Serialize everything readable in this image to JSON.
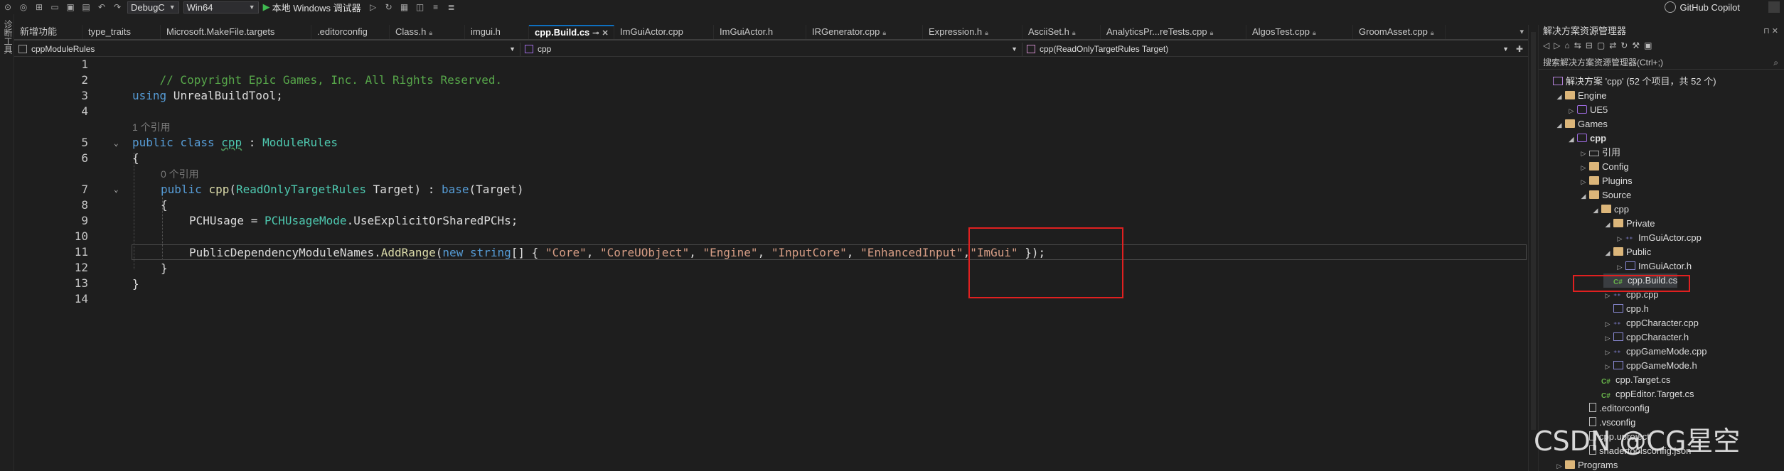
{
  "toolbar": {
    "config": "DebugC",
    "platform": "Win64",
    "run_label": "本地 Windows 调试器",
    "copilot": "GitHub Copilot"
  },
  "side_strip": {
    "label": "诊断工具"
  },
  "tabs": [
    {
      "label": "新增功能",
      "locked": false,
      "active": false
    },
    {
      "label": "type_traits",
      "locked": false,
      "active": false
    },
    {
      "label": "Microsoft.MakeFile.targets",
      "locked": false,
      "active": false
    },
    {
      "label": ".editorconfig",
      "locked": false,
      "active": false
    },
    {
      "label": "Class.h",
      "locked": true,
      "active": false
    },
    {
      "label": "imgui.h",
      "locked": false,
      "active": false
    },
    {
      "label": "cpp.Build.cs",
      "locked": false,
      "active": true
    },
    {
      "label": "ImGuiActor.cpp",
      "locked": false,
      "active": false
    },
    {
      "label": "ImGuiActor.h",
      "locked": false,
      "active": false
    },
    {
      "label": "IRGenerator.cpp",
      "locked": true,
      "active": false
    },
    {
      "label": "Expression.h",
      "locked": true,
      "active": false
    },
    {
      "label": "AsciiSet.h",
      "locked": true,
      "active": false
    },
    {
      "label": "AnalyticsPr...reTests.cpp",
      "locked": true,
      "active": false
    },
    {
      "label": "AlgosTest.cpp",
      "locked": true,
      "active": false
    },
    {
      "label": "GroomAsset.cpp",
      "locked": true,
      "active": false
    }
  ],
  "navbar": {
    "scope": "cppModuleRules",
    "project": "cpp",
    "member": "cpp(ReadOnlyTargetRules Target)"
  },
  "editor": {
    "line_numbers": [
      "1",
      "2",
      "3",
      "4",
      "5",
      "6",
      "7",
      "8",
      "9",
      "10",
      "11",
      "12",
      "13",
      "14"
    ],
    "refs_hint_1": "1 个引用",
    "refs_hint_2": "0 个引用",
    "line1": "// Copyright Epic Games, Inc. All Rights Reserved.",
    "l3_kw": "using",
    "l3_rest": " UnrealBuildTool;",
    "l5_kw1": "public",
    "l5_kw2": "class",
    "l5_name": "cpp",
    "l5_sep": " : ",
    "l5_base": "ModuleRules",
    "brace_open": "{",
    "brace_close": "}",
    "l7_kw": "public",
    "l7_name": "cpp",
    "l7_p1": "(",
    "l7_type": "ReadOnlyTargetRules",
    "l7_param": " Target) : ",
    "l7_base": "base",
    "l7_end": "(Target)",
    "l9_a": "PCHUsage = ",
    "l9_type": "PCHUsageMode",
    "l9_b": ".UseExplicitOrSharedPCHs;",
    "l11_a": "PublicDependencyModuleNames.",
    "l11_method": "AddRange",
    "l11_b": "(",
    "l11_new": "new",
    "l11_string": "string",
    "l11_c": "[] { ",
    "l11_s1": "\"Core\"",
    "l11_s2": "\"CoreUObject\"",
    "l11_s3": "\"Engine\"",
    "l11_s4": "\"InputCore\"",
    "l11_s5": "\"EnhancedInput\"",
    "l11_s6": "\"ImGui\"",
    "comma_sp": ", ",
    "comma": ",",
    "l11_end": " });"
  },
  "solution_explorer": {
    "title": "解决方案资源管理器",
    "search_placeholder": "搜索解决方案资源管理器(Ctrl+;)",
    "nodes": [
      {
        "label": "解决方案 'cpp' (52 个项目，共 52 个)",
        "icon": "solution",
        "expand": ""
      },
      {
        "label": "Engine",
        "icon": "folder",
        "expand": "open"
      },
      {
        "label": "UE5",
        "icon": "project",
        "expand": "closed"
      },
      {
        "label": "Games",
        "icon": "folder",
        "expand": "open"
      },
      {
        "label": "cpp",
        "icon": "project",
        "expand": "open"
      },
      {
        "label": "引用",
        "icon": "ref",
        "expand": "closed"
      },
      {
        "label": "Config",
        "icon": "folder",
        "expand": "closed"
      },
      {
        "label": "Plugins",
        "icon": "folder",
        "expand": "closed"
      },
      {
        "label": "Source",
        "icon": "folder",
        "expand": "open"
      },
      {
        "label": "cpp",
        "icon": "folder",
        "expand": "open"
      },
      {
        "label": "Private",
        "icon": "folder",
        "expand": "open"
      },
      {
        "label": "ImGuiActor.cpp",
        "icon": "cpp",
        "expand": "closed"
      },
      {
        "label": "Public",
        "icon": "folder",
        "expand": "open"
      },
      {
        "label": "ImGuiActor.h",
        "icon": "h",
        "expand": "closed"
      },
      {
        "label": "cpp.Build.cs",
        "icon": "cs",
        "expand": ""
      },
      {
        "label": "cpp.cpp",
        "icon": "cpp",
        "expand": "closed"
      },
      {
        "label": "cpp.h",
        "icon": "h",
        "expand": ""
      },
      {
        "label": "cppCharacter.cpp",
        "icon": "cpp",
        "expand": "closed"
      },
      {
        "label": "cppCharacter.h",
        "icon": "h",
        "expand": "closed"
      },
      {
        "label": "cppGameMode.cpp",
        "icon": "cpp",
        "expand": "closed"
      },
      {
        "label": "cppGameMode.h",
        "icon": "h",
        "expand": "closed"
      },
      {
        "label": "cpp.Target.cs",
        "icon": "cs",
        "expand": ""
      },
      {
        "label": "cppEditor.Target.cs",
        "icon": "cs",
        "expand": ""
      },
      {
        "label": ".editorconfig",
        "icon": "file",
        "expand": ""
      },
      {
        "label": ".vsconfig",
        "icon": "file",
        "expand": ""
      },
      {
        "label": "cpp.uproject",
        "icon": "file",
        "expand": ""
      },
      {
        "label": "shadertoolsconfig.json",
        "icon": "file",
        "expand": ""
      },
      {
        "label": "Programs",
        "icon": "folder",
        "expand": "closed"
      }
    ]
  },
  "watermark": "CSDN @CG星空",
  "colors": {
    "accent": "#0e70c0",
    "annotation_red": "#e02020",
    "keyword": "#569cd6",
    "type": "#4ec9b0",
    "string": "#d69d85",
    "comment": "#57a64a"
  }
}
